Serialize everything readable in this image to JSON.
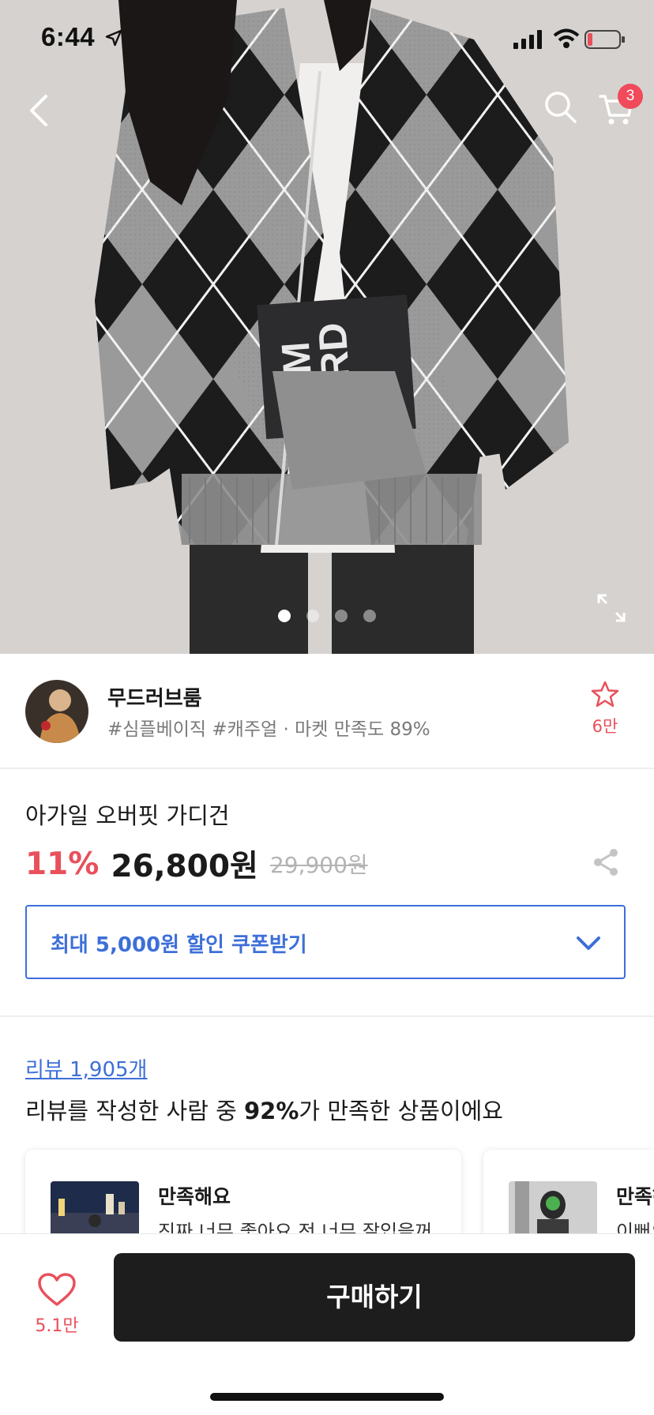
{
  "status": {
    "time": "6:44"
  },
  "nav": {
    "cart_count": "3"
  },
  "hero": {
    "book_text_line1": "TOM",
    "book_text_line2": "ORD",
    "page_indicator": {
      "total": 4,
      "active": 1
    }
  },
  "shop": {
    "name": "무드러브룸",
    "meta": "#심플베이직 #캐주얼 · 마켓 만족도 89%",
    "favorite_count": "6만"
  },
  "product": {
    "name": "아가일 오버핏 가디건",
    "discount": "11%",
    "price": "26,800원",
    "original_price": "29,900원"
  },
  "coupon": {
    "label": "최대 5,000원 할인 쿠폰받기"
  },
  "reviews": {
    "link": "리뷰 1,905개",
    "summary_prefix": "리뷰를 작성한 사람 중 ",
    "summary_percent": "92%",
    "summary_suffix": "가 만족한 상품이에요",
    "cards": [
      {
        "title": "만족해요",
        "text": "진짜 너무 좋아요 전 너무 잘입을꺼"
      },
      {
        "title": "만족해",
        "text": "이뻐요"
      }
    ]
  },
  "bottom": {
    "like_count": "5.1만",
    "buy_label": "구매하기"
  },
  "colors": {
    "accent_red": "#e8505b",
    "accent_blue": "#3d6fd8",
    "buy_bg": "#1d1d1d"
  }
}
